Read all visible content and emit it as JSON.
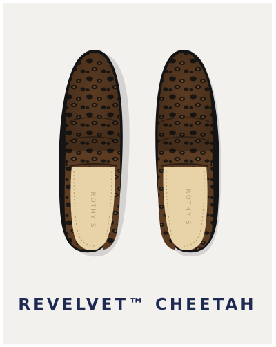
{
  "product": {
    "name": "REVELVET™ CHEETAH",
    "insole_logo": "ROTHY'S",
    "image_alt": "Pair of leopard-print velvet loafer mules, top view"
  },
  "colors": {
    "background": "#f2f1ee",
    "caption": "#1e2a52",
    "upper": "#5b3b22",
    "spots": "#1a1714",
    "insole": "#e7d3a7",
    "sole": "#141414"
  }
}
